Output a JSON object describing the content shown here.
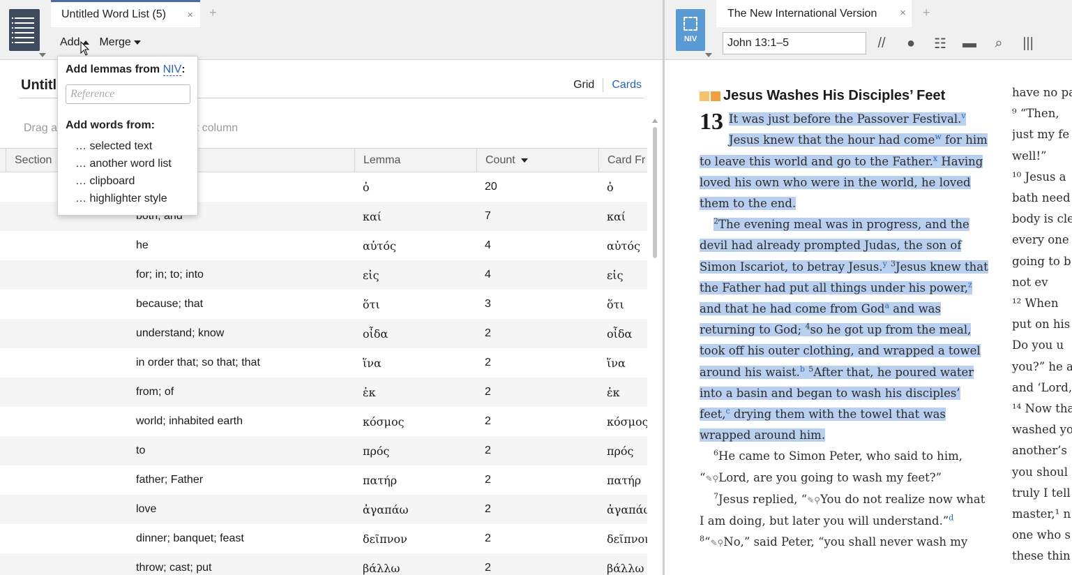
{
  "left_panel": {
    "tab_title": "Untitled Word List (5)",
    "tab_close": "×",
    "tab_add": "+",
    "toolbar": {
      "add_label": "Add",
      "merge_label": "Merge"
    },
    "list_title": "Untitl",
    "view_toggle": {
      "grid": "Grid",
      "cards": "Cards"
    },
    "drag_hint_a": "Drag a",
    "drag_hint_b": "hat column",
    "columns": {
      "section": "Section",
      "lemma": "Lemma",
      "count": "Count",
      "card_front": "Card Fr"
    },
    "rows": [
      {
        "gloss": "",
        "lemma": "ὁ",
        "count": "20",
        "card": "ὁ"
      },
      {
        "gloss": "both; and",
        "lemma": "καί",
        "count": "7",
        "card": "καί"
      },
      {
        "gloss": "he",
        "lemma": "αὐτός",
        "count": "4",
        "card": "αὐτός"
      },
      {
        "gloss": "for; in; to; into",
        "lemma": "εἰς",
        "count": "4",
        "card": "εἰς"
      },
      {
        "gloss": "because; that",
        "lemma": "ὅτι",
        "count": "3",
        "card": "ὅτι"
      },
      {
        "gloss": "understand; know",
        "lemma": "οἶδα",
        "count": "2",
        "card": "οἶδα"
      },
      {
        "gloss": "in order that; so that; that",
        "lemma": "ἵνα",
        "count": "2",
        "card": "ἵνα"
      },
      {
        "gloss": "from; of",
        "lemma": "ἐκ",
        "count": "2",
        "card": "ἐκ"
      },
      {
        "gloss": "world; inhabited earth",
        "lemma": "κόσμος",
        "count": "2",
        "card": "κόσμος"
      },
      {
        "gloss": "to",
        "lemma": "πρός",
        "count": "2",
        "card": "πρός"
      },
      {
        "gloss": "father; Father",
        "lemma": "πατήρ",
        "count": "2",
        "card": "πατήρ"
      },
      {
        "gloss": "love",
        "lemma": "ἀγαπάω",
        "count": "2",
        "card": "ἀγαπάω"
      },
      {
        "gloss": "dinner; banquet; feast",
        "lemma": "δεῖπνον",
        "count": "2",
        "card": "δεῖπνον"
      },
      {
        "gloss": "throw; cast; put",
        "lemma": "βάλλω",
        "count": "2",
        "card": "βάλλω"
      }
    ],
    "dropdown": {
      "lemmas_prefix": "Add lemmas from ",
      "lemmas_source": "NIV",
      "lemmas_suffix": ":",
      "reference_placeholder": "Reference",
      "words_heading": "Add words from:",
      "items": [
        "… selected text",
        "… another word list",
        "… clipboard",
        "… highlighter style"
      ]
    }
  },
  "right_panel": {
    "resource_abbrev": "NIV",
    "tab_title": "The New International Version",
    "tab_close": "×",
    "tab_add": "+",
    "reference": "John 13:1–5",
    "heading": "Jesus Washes His Disciples’ Feet",
    "chapter": "13",
    "v1": "It was just before the Passover Festival.",
    "fn_v": "v",
    "v1b": "Jesus knew that the hour had come",
    "fn_w": "w",
    "v1c": " for him to leave this world and go to the Father.",
    "fn_x": "x",
    "v1d": " Having loved his own who were in the world, he loved them to the end.",
    "vn2": "2",
    "v2": "The evening meal was in progress, and the devil had already prompted Judas, the son of Simon Iscariot, to betray Jesus.",
    "fn_y": "y",
    "vn3": "3",
    "v3": "Jesus knew that the Father had put all things under his power,",
    "fn_z": "z",
    "v3b": " and that he had come from God",
    "fn_a": "a",
    "v3c": " and was returning to God;",
    "vn4": "4",
    "v4": "so he got up from the meal, took off his outer clothing, and wrapped a towel around his waist.",
    "fn_b": "b",
    "vn5": "5",
    "v5": "After that, he poured water into a basin and began to wash his disciples’ feet,",
    "fn_c": "c",
    "v5b": " drying them with the towel that was wrapped around him.",
    "vn6": "6",
    "v6a": "He came to Simon Peter, who said to him, “",
    "v6b": "Lord, are you going to wash my feet?”",
    "vn7": "7",
    "v7a": "Jesus replied, “",
    "v7b": "You do not realize now what I am doing, but later you will understand.”",
    "fn_d": "d",
    "vn8": "8",
    "v8a": "“",
    "v8b": "No,” said Peter, “you shall never wash my",
    "col2_lines": [
      "have no pa",
      "⁹ “Then,",
      "just my fe",
      "well!”",
      "¹⁰ Jesus a",
      "bath need",
      "body is cle",
      "every one",
      "going to b",
      "not ev",
      "¹² When",
      "put on his",
      "Do you u",
      "you?” he a",
      "and ‘Lord,",
      "¹⁴ Now tha",
      "washed yo",
      "another’s",
      "you shoul",
      "truly I tell",
      "master,¹ n",
      "one who s",
      "these thin"
    ]
  }
}
